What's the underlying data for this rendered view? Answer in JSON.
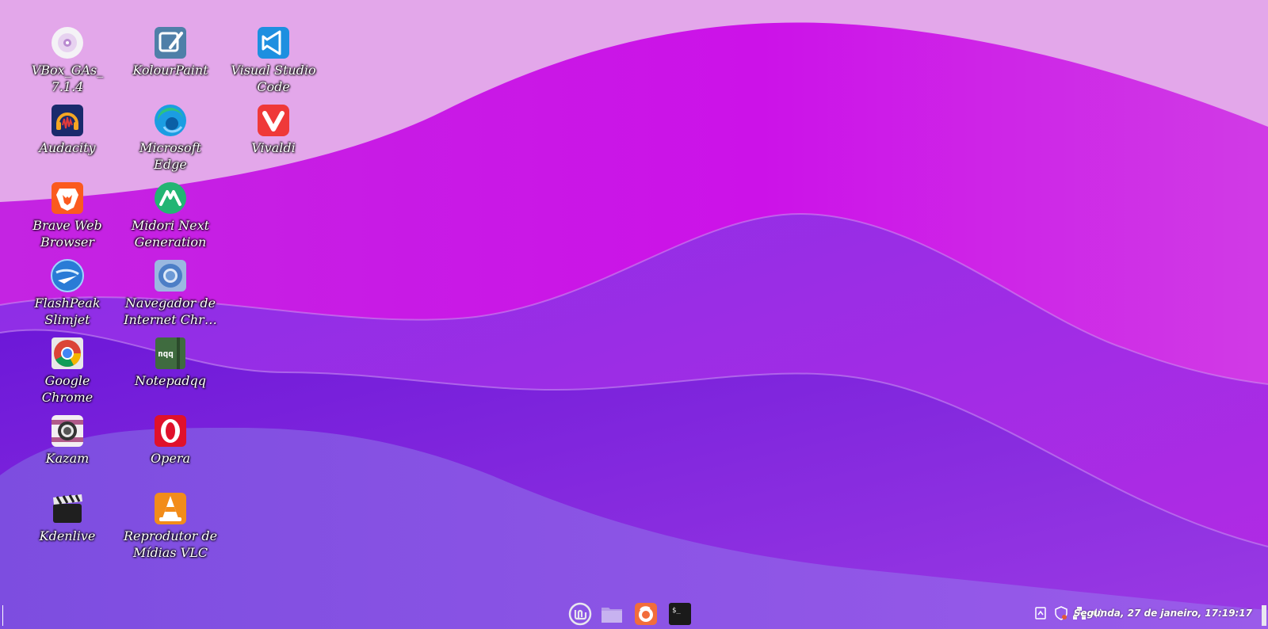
{
  "desktop": {
    "icons": [
      {
        "label": "VBox_GAs_ 7.1.4",
        "icon": "cd-icon"
      },
      {
        "label": "KolourPaint",
        "icon": "kolourpaint-icon"
      },
      {
        "label": "Visual Studio Code",
        "icon": "vscode-icon"
      },
      {
        "label": "Audacity",
        "icon": "audacity-icon"
      },
      {
        "label": "Microsoft Edge",
        "icon": "edge-icon"
      },
      {
        "label": "Vivaldi",
        "icon": "vivaldi-icon"
      },
      {
        "label": "Brave Web Browser",
        "icon": "brave-icon"
      },
      {
        "label": "Midori Next Generation",
        "icon": "midori-icon"
      },
      {
        "label": "FlashPeak Slimjet",
        "icon": "slimjet-icon"
      },
      {
        "label": "Navegador de Internet Chr…",
        "icon": "chromium-icon"
      },
      {
        "label": "Google Chrome",
        "icon": "chrome-icon"
      },
      {
        "label": "Notepadqq",
        "icon": "notepadqq-icon"
      },
      {
        "label": "Kazam",
        "icon": "kazam-icon"
      },
      {
        "label": "Opera",
        "icon": "opera-icon"
      },
      {
        "label": "Kdenlive",
        "icon": "kdenlive-icon"
      },
      {
        "label": "Reprodutor de Mídias VLC",
        "icon": "vlc-icon"
      }
    ]
  },
  "taskbar": {
    "launchers": [
      {
        "name": "menu",
        "icon": "mint-menu-icon"
      },
      {
        "name": "files",
        "icon": "folder-icon"
      },
      {
        "name": "firefox",
        "icon": "firefox-icon"
      },
      {
        "name": "terminal",
        "icon": "terminal-icon"
      }
    ],
    "terminal_glyph": "$_",
    "tray": [
      "notes-icon",
      "shield-icon",
      "network-icon",
      "volume-icon"
    ],
    "clock": "Segunda, 27 de janeiro, 17:19:17"
  },
  "colors": {
    "wallpaper_top": "#e3a7ea",
    "wallpaper_magenta": "#c81ee6",
    "wallpaper_violet": "#7e36e1"
  }
}
